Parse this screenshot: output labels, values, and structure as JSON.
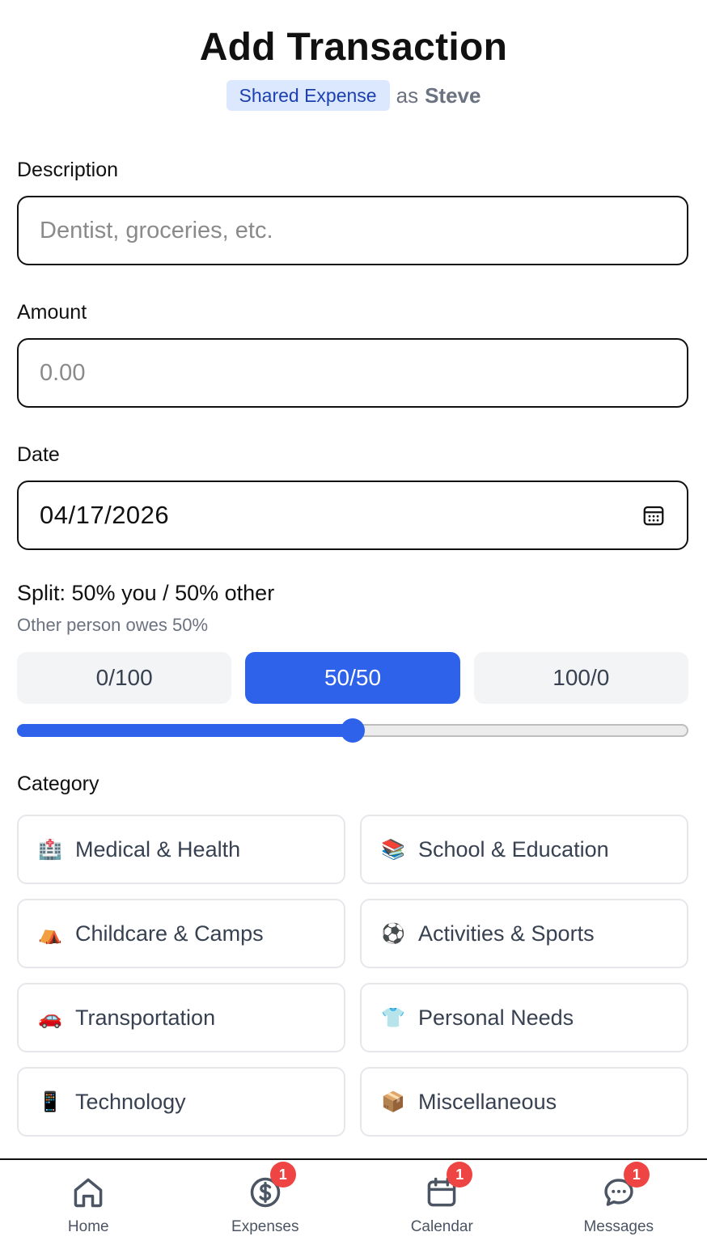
{
  "header": {
    "title": "Add Transaction",
    "badge": "Shared Expense",
    "as_text": "as",
    "user": "Steve"
  },
  "form": {
    "description": {
      "label": "Description",
      "placeholder": "Dentist, groceries, etc.",
      "value": ""
    },
    "amount": {
      "label": "Amount",
      "placeholder": "0.00",
      "value": ""
    },
    "date": {
      "label": "Date",
      "value": "04/17/2026"
    }
  },
  "split": {
    "label": "Split: 50% you / 50% other",
    "hint": "Other person owes 50%",
    "options": [
      "0/100",
      "50/50",
      "100/0"
    ],
    "selected": "50/50",
    "value_percent": 50
  },
  "category": {
    "label": "Category",
    "items": [
      {
        "icon": "hospital-icon",
        "emoji": "🏥",
        "label": "Medical & Health"
      },
      {
        "icon": "books-icon",
        "emoji": "📚",
        "label": "School & Education"
      },
      {
        "icon": "tent-icon",
        "emoji": "⛺",
        "label": "Childcare & Camps"
      },
      {
        "icon": "soccer-ball-icon",
        "emoji": "⚽",
        "label": "Activities & Sports"
      },
      {
        "icon": "car-icon",
        "emoji": "🚗",
        "label": "Transportation"
      },
      {
        "icon": "shirt-icon",
        "emoji": "👕",
        "label": "Personal Needs"
      },
      {
        "icon": "phone-icon",
        "emoji": "📱",
        "label": "Technology"
      },
      {
        "icon": "package-icon",
        "emoji": "📦",
        "label": "Miscellaneous"
      }
    ]
  },
  "nav": {
    "items": [
      {
        "label": "Home",
        "icon": "home-icon",
        "badge": ""
      },
      {
        "label": "Expenses",
        "icon": "dollar-icon",
        "badge": "1"
      },
      {
        "label": "Calendar",
        "icon": "calendar-icon",
        "badge": "1"
      },
      {
        "label": "Messages",
        "icon": "chat-icon",
        "badge": "1"
      }
    ]
  },
  "colors": {
    "accent": "#2f62ea",
    "badge_bg": "#dbe8fd",
    "badge_text": "#1e40af",
    "notification": "#ef4444"
  }
}
